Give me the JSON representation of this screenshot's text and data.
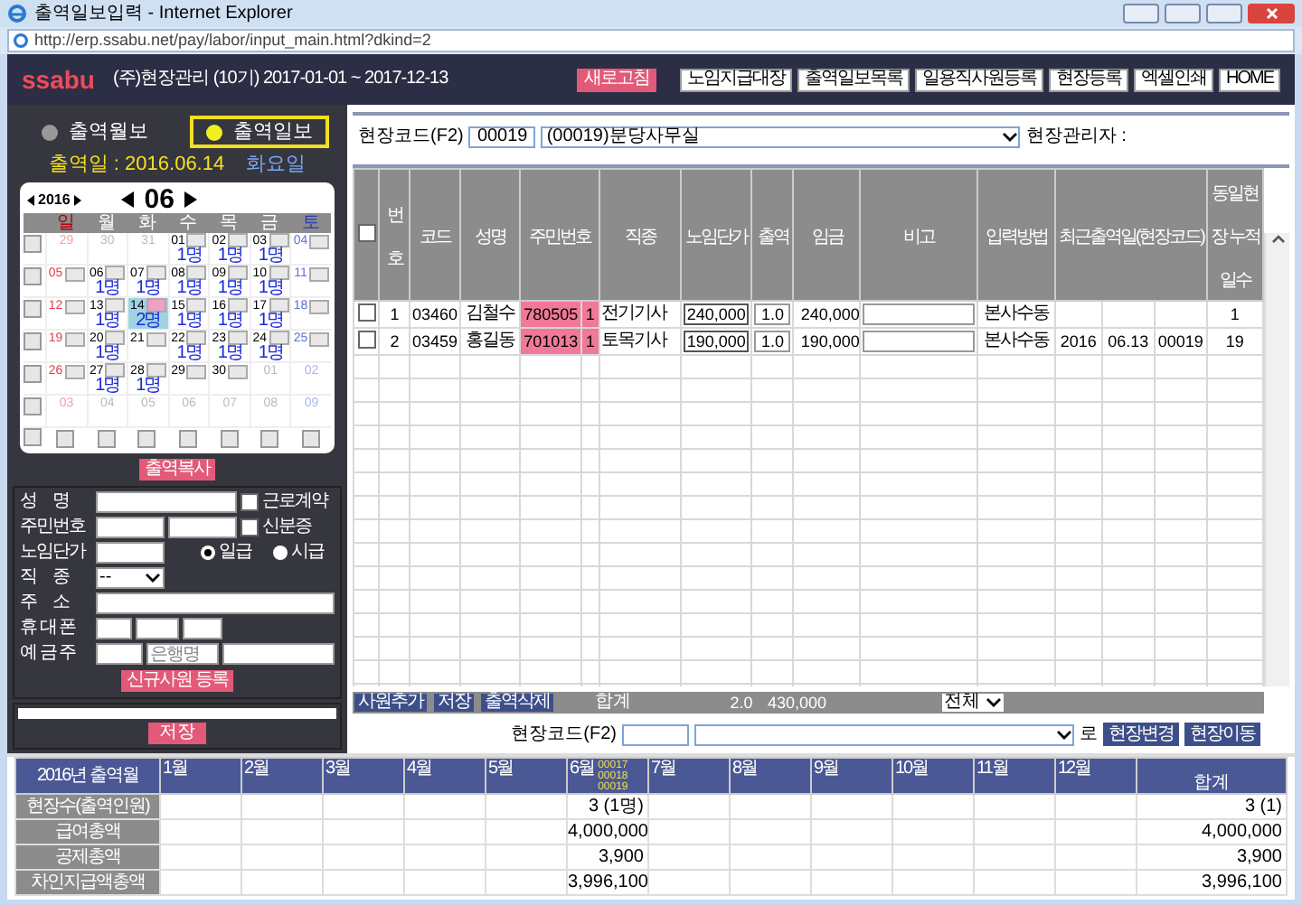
{
  "window": {
    "title": "출역일보입력 - Internet Explorer",
    "address": "http://erp.ssabu.net/pay/labor/input_main.html?dkind=2"
  },
  "header": {
    "logo": "ssabu",
    "company": "(주)현장관리 (10기) 2017-01-01 ~ 2017-12-13",
    "buttons": [
      {
        "label": "새로고침",
        "kind": "accent"
      },
      {
        "label": "노임지급대장",
        "kind": "plain"
      },
      {
        "label": "출역일보목록",
        "kind": "plain"
      },
      {
        "label": "일용직사원등록",
        "kind": "plain"
      },
      {
        "label": "현장등록",
        "kind": "plain"
      },
      {
        "label": "엑셀인쇄",
        "kind": "plain"
      },
      {
        "label": "HOME",
        "kind": "plain"
      }
    ]
  },
  "mode_toggle": [
    {
      "label": "출역월보",
      "selected": false
    },
    {
      "label": "출역일보",
      "selected": true
    }
  ],
  "work_date": {
    "label": "출역일 : 2016.06.14",
    "weekday": "화요일"
  },
  "calendar": {
    "year": "2016",
    "month": "06",
    "weekdays": [
      "일",
      "월",
      "화",
      "수",
      "목",
      "금",
      "토"
    ],
    "weeks": [
      {
        "checked": false,
        "days": [
          {
            "day": "29",
            "in_month": false,
            "selected": false
          },
          {
            "day": "30",
            "in_month": false,
            "selected": false
          },
          {
            "day": "31",
            "in_month": false,
            "selected": false
          },
          {
            "day": "01",
            "in_month": true,
            "selected": false,
            "count": "1명"
          },
          {
            "day": "02",
            "in_month": true,
            "selected": false,
            "count": "1명"
          },
          {
            "day": "03",
            "in_month": true,
            "selected": false,
            "count": "1명"
          },
          {
            "day": "04",
            "in_month": true,
            "selected": false
          }
        ]
      },
      {
        "checked": false,
        "days": [
          {
            "day": "05",
            "in_month": true,
            "selected": false
          },
          {
            "day": "06",
            "in_month": true,
            "selected": false,
            "count": "1명"
          },
          {
            "day": "07",
            "in_month": true,
            "selected": false,
            "count": "1명"
          },
          {
            "day": "08",
            "in_month": true,
            "selected": false,
            "count": "1명"
          },
          {
            "day": "09",
            "in_month": true,
            "selected": false,
            "count": "1명"
          },
          {
            "day": "10",
            "in_month": true,
            "selected": false,
            "count": "1명"
          },
          {
            "day": "11",
            "in_month": true,
            "selected": false
          }
        ]
      },
      {
        "checked": false,
        "days": [
          {
            "day": "12",
            "in_month": true,
            "selected": false
          },
          {
            "day": "13",
            "in_month": true,
            "selected": false,
            "count": "1명"
          },
          {
            "day": "14",
            "in_month": true,
            "selected": true,
            "count": "2명"
          },
          {
            "day": "15",
            "in_month": true,
            "selected": false,
            "count": "1명"
          },
          {
            "day": "16",
            "in_month": true,
            "selected": false,
            "count": "1명"
          },
          {
            "day": "17",
            "in_month": true,
            "selected": false,
            "count": "1명"
          },
          {
            "day": "18",
            "in_month": true,
            "selected": false
          }
        ]
      },
      {
        "checked": false,
        "days": [
          {
            "day": "19",
            "in_month": true,
            "selected": false
          },
          {
            "day": "20",
            "in_month": true,
            "selected": false,
            "count": "1명"
          },
          {
            "day": "21",
            "in_month": true,
            "selected": false
          },
          {
            "day": "22",
            "in_month": true,
            "selected": false,
            "count": "1명"
          },
          {
            "day": "23",
            "in_month": true,
            "selected": false,
            "count": "1명"
          },
          {
            "day": "24",
            "in_month": true,
            "selected": false,
            "count": "1명"
          },
          {
            "day": "25",
            "in_month": true,
            "selected": false
          }
        ]
      },
      {
        "checked": false,
        "days": [
          {
            "day": "26",
            "in_month": true,
            "selected": false
          },
          {
            "day": "27",
            "in_month": true,
            "selected": false,
            "count": "1명"
          },
          {
            "day": "28",
            "in_month": true,
            "selected": false,
            "count": "1명"
          },
          {
            "day": "29",
            "in_month": true,
            "selected": false
          },
          {
            "day": "30",
            "in_month": true,
            "selected": false
          },
          {
            "day": "01",
            "in_month": false,
            "selected": false
          },
          {
            "day": "02",
            "in_month": false,
            "selected": false
          }
        ]
      },
      {
        "checked": false,
        "days": [
          {
            "day": "03",
            "in_month": false,
            "selected": false
          },
          {
            "day": "04",
            "in_month": false,
            "selected": false
          },
          {
            "day": "05",
            "in_month": false,
            "selected": false
          },
          {
            "day": "06",
            "in_month": false,
            "selected": false
          },
          {
            "day": "07",
            "in_month": false,
            "selected": false
          },
          {
            "day": "08",
            "in_month": false,
            "selected": false
          },
          {
            "day": "09",
            "in_month": false,
            "selected": false
          }
        ]
      }
    ],
    "column_checks": [
      {
        "checked": false
      },
      {
        "checked": false
      },
      {
        "checked": false
      },
      {
        "checked": false
      },
      {
        "checked": false
      },
      {
        "checked": false
      },
      {
        "checked": false
      },
      {
        "checked": false
      }
    ]
  },
  "copy_button": "출역복사",
  "employee_form": {
    "name_label": "성　명",
    "id_label": "주민번호",
    "wage_label": "노임단가",
    "job_label": "직　종",
    "address_label": "주　소",
    "phone_label": "휴 대 폰",
    "holder_label": "예 금 주",
    "contract_check": {
      "label": "근로계약",
      "checked": false
    },
    "id_card_check": {
      "label": "신분증",
      "checked": false
    },
    "pay_types": [
      {
        "label": "일급",
        "selected": true
      },
      {
        "label": "시급",
        "selected": false
      }
    ],
    "job_select": "--",
    "bank_placeholder": "은행명",
    "register_button": "신규사원 등록"
  },
  "memo": {
    "save_button": "저장"
  },
  "site": {
    "label": "현장코드(F2)",
    "code": "00019",
    "name": "(00019)분당사무실",
    "manager_label": "현장관리자 :"
  },
  "table": {
    "all_checked": false,
    "columns": [
      "번호",
      "코드",
      "성명",
      "주민번호",
      "직종",
      "노임단가",
      "출역",
      "임금",
      "비고",
      "입력방법",
      "최근출역일(현장코드)",
      "동일현장 누적일수"
    ],
    "rows": [
      {
        "checked": false,
        "no": "1",
        "code": "03460",
        "name": "김철수",
        "id_front": "780505",
        "id_back": "1",
        "job": "전기기사",
        "unit_wage": "240,000",
        "days": "1.0",
        "wage": "240,000",
        "method": "본사수동",
        "cumulative": "1"
      },
      {
        "checked": false,
        "no": "2",
        "code": "03459",
        "name": "홍길동",
        "id_front": "701013",
        "id_back": "1",
        "job": "토목기사",
        "unit_wage": "190,000",
        "days": "1.0",
        "wage": "190,000",
        "method": "본사수동",
        "recent_year": "2016",
        "recent_date": "06.13",
        "recent_site": "00019",
        "cumulative": "19"
      }
    ]
  },
  "footer": {
    "buttons": [
      "사원추가",
      "저장",
      "출역삭제"
    ],
    "total_label": "합계",
    "total_days": "2.0",
    "total_wage": "430,000",
    "filter": "전체"
  },
  "move": {
    "label": "현장코드(F2)",
    "suffix": "로",
    "buttons": [
      "현장변경",
      "현장이동"
    ]
  },
  "summary": {
    "corner": "2016년 출역월",
    "total_label": "합계",
    "row_labels": [
      "현장수(출역인원)",
      "급여총액",
      "공제총액",
      "차인지급액총액"
    ],
    "months": [
      {
        "label": "1월"
      },
      {
        "label": "2월"
      },
      {
        "label": "3월"
      },
      {
        "label": "4월"
      },
      {
        "label": "5월"
      },
      {
        "label": "6월",
        "codes": [
          "00017",
          "00018",
          "00019"
        ],
        "values": [
          "3 (1명)",
          "4,000,000",
          "3,900",
          "3,996,100"
        ]
      },
      {
        "label": "7월"
      },
      {
        "label": "8월"
      },
      {
        "label": "9월"
      },
      {
        "label": "10월"
      },
      {
        "label": "11월"
      },
      {
        "label": "12월"
      }
    ],
    "totals": [
      "3 (1)",
      "4,000,000",
      "3,900",
      "3,996,100"
    ]
  }
}
